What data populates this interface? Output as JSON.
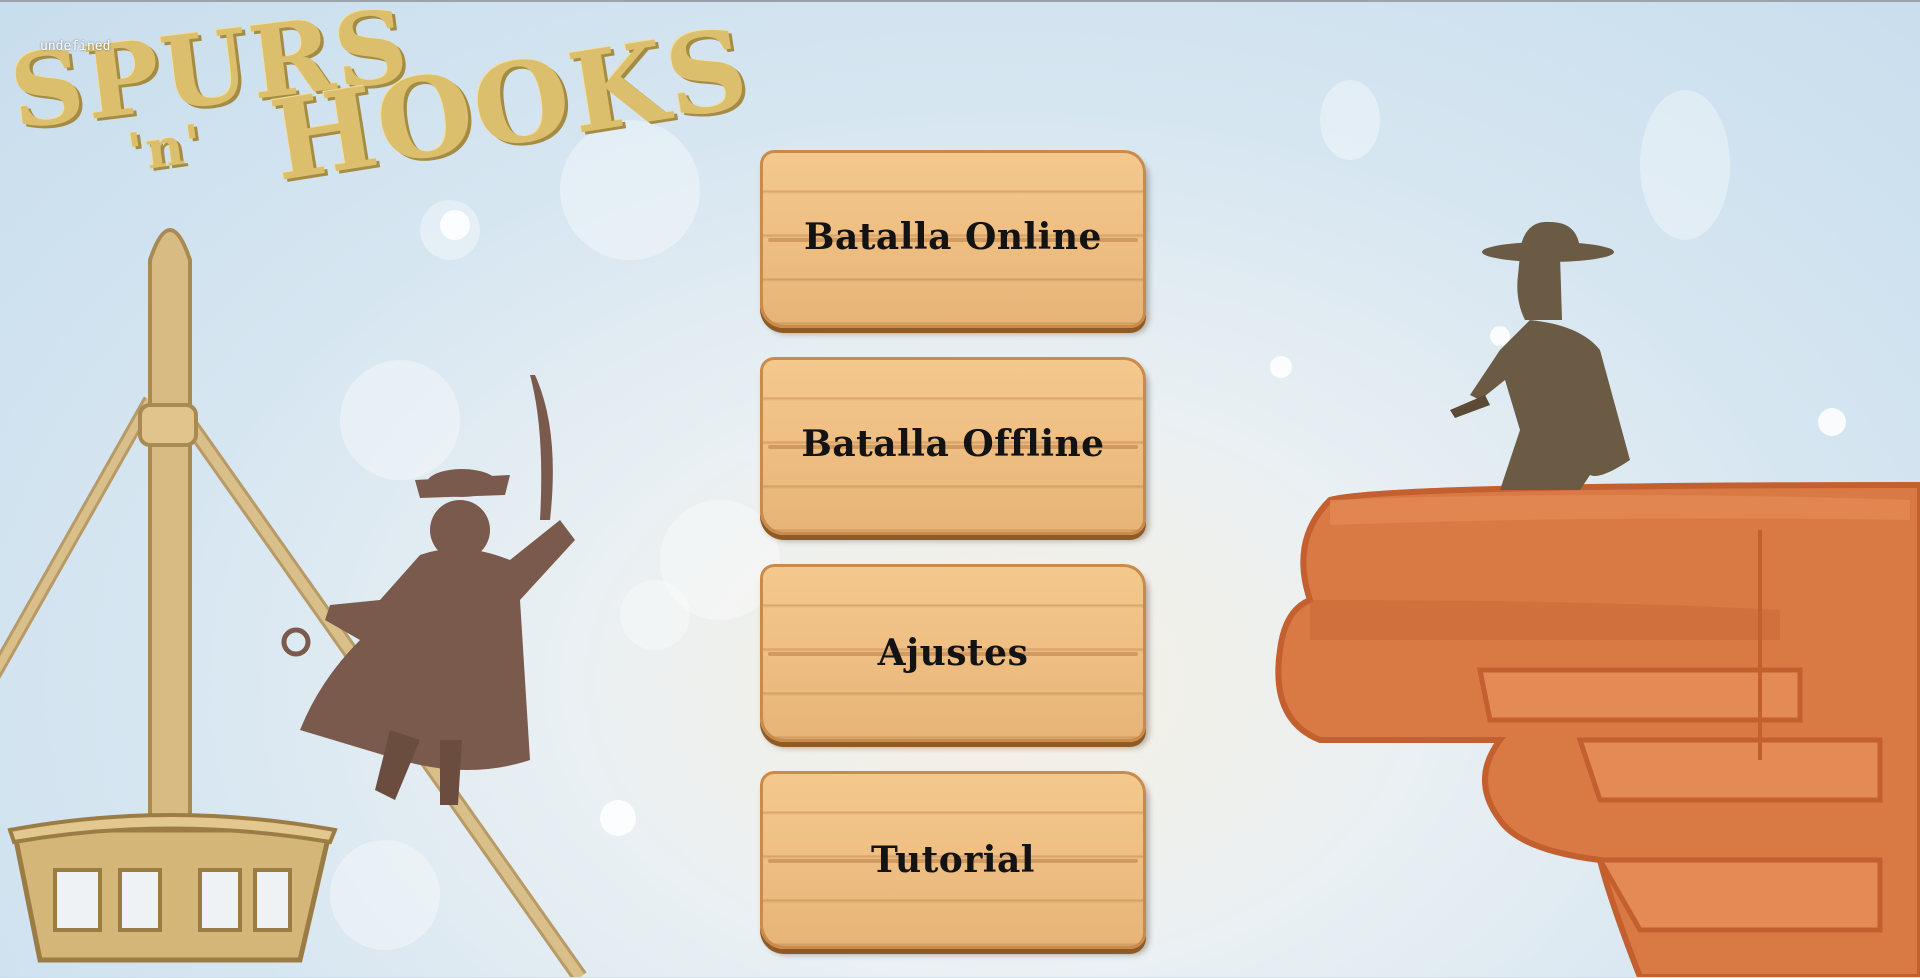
{
  "debug_text": "undefined",
  "logo": {
    "line1": "SPURS",
    "line2": "'n'",
    "line3": "HOOKS"
  },
  "menu": {
    "items": [
      {
        "label": "Batalla Online"
      },
      {
        "label": "Batalla Offline"
      },
      {
        "label": "Ajustes"
      },
      {
        "label": "Tutorial"
      }
    ]
  },
  "colors": {
    "plank": "#efbf83",
    "plank_edge": "#8f5a23",
    "logo": "#dcbf6c",
    "rock": "#d97a45",
    "pirate": "#7a5a4c",
    "cowboy": "#6b5a44"
  }
}
